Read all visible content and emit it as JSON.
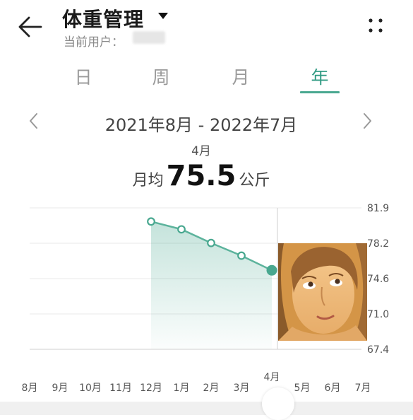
{
  "header": {
    "title": "体重管理",
    "user_label": "当前用户："
  },
  "tabs": [
    {
      "label": "日",
      "active": false
    },
    {
      "label": "周",
      "active": false
    },
    {
      "label": "月",
      "active": false
    },
    {
      "label": "年",
      "active": true
    }
  ],
  "colors": {
    "accent": "#49a890",
    "active_tab": "#2f9a82"
  },
  "icons": [
    "back-arrow-icon",
    "caret-down-icon",
    "more-icon",
    "chevron-left-icon",
    "chevron-right-icon"
  ],
  "period": {
    "range": "2021年8月 - 2022年7月"
  },
  "summary": {
    "selected_month": "4月",
    "prefix": "月均",
    "value": "75.5",
    "unit": "公斤"
  },
  "chart_data": {
    "type": "area",
    "title": "",
    "x": [
      "8月",
      "9月",
      "10月",
      "11月",
      "12月",
      "1月",
      "2月",
      "3月",
      "4月",
      "5月",
      "6月",
      "7月"
    ],
    "series": [
      {
        "values": [
          null,
          null,
          null,
          null,
          80.5,
          79.7,
          78.3,
          77.0,
          75.5,
          null,
          null,
          null
        ]
      }
    ],
    "yticks": [
      "81.9",
      "78.2",
      "74.6",
      "71.0",
      "67.4"
    ],
    "ylim": [
      67.4,
      81.9
    ],
    "selected": "4月",
    "grid": true
  }
}
